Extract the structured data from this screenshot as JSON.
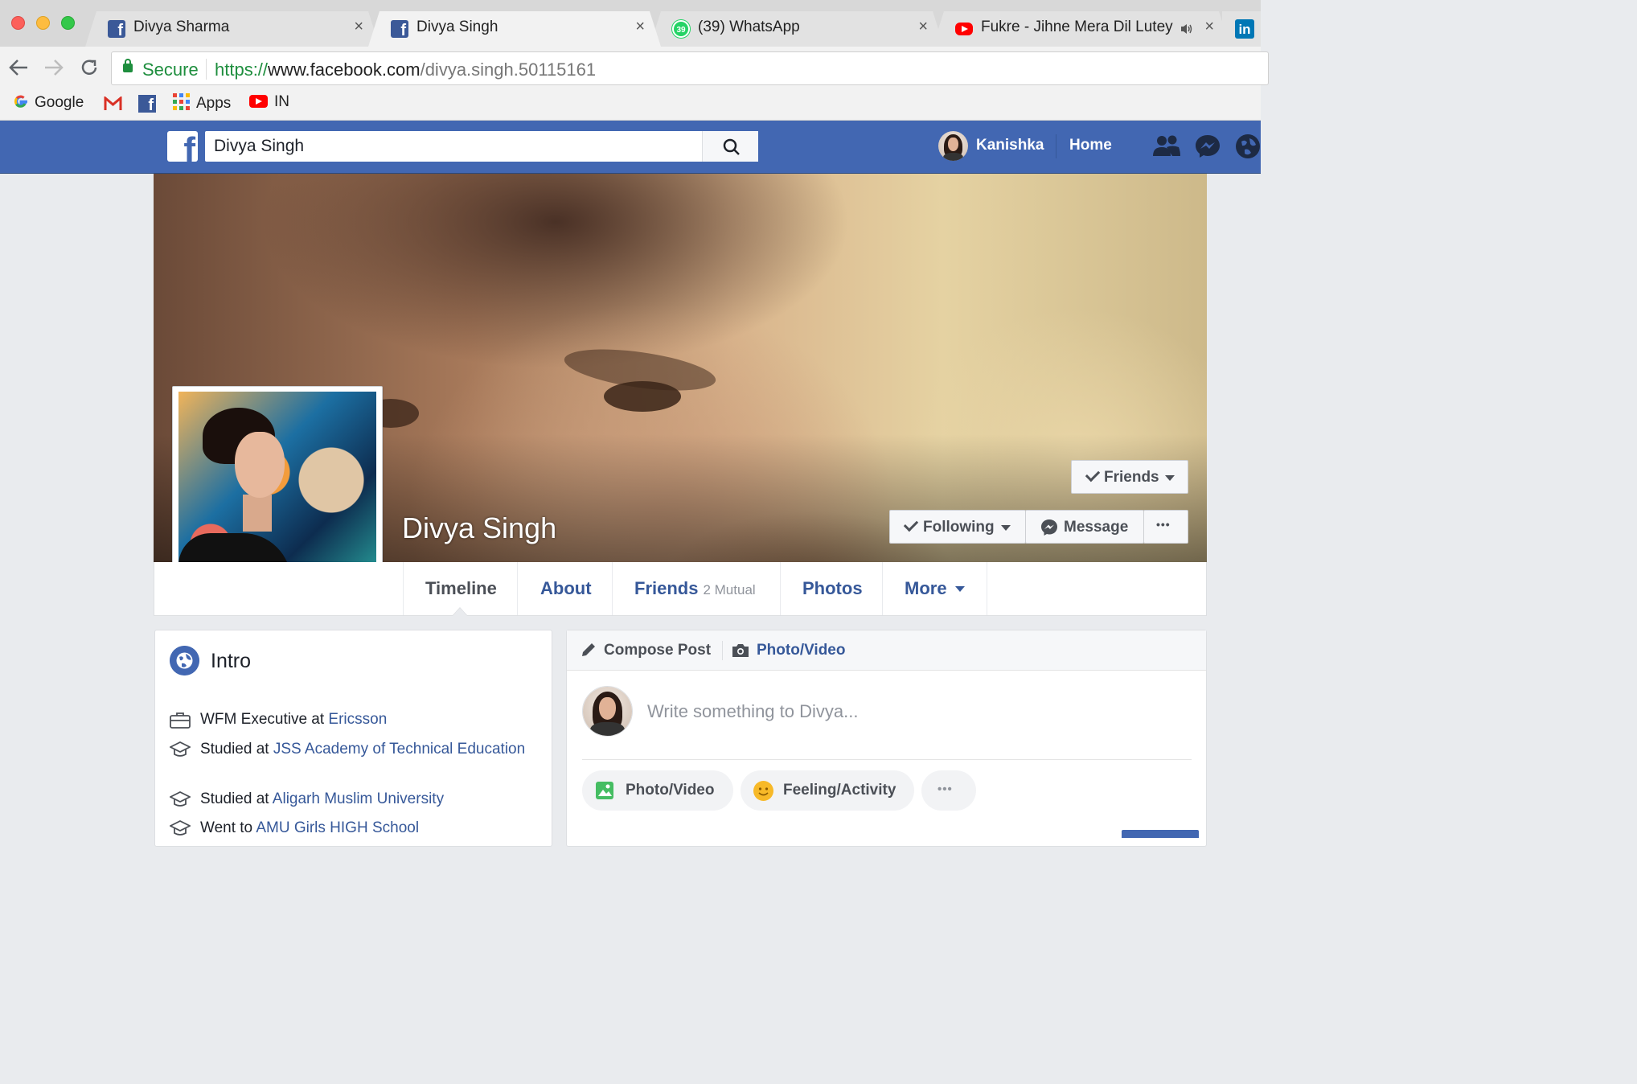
{
  "browser": {
    "tabs": [
      {
        "title": "Divya Sharma",
        "icon": "facebook-icon",
        "active": false
      },
      {
        "title": "Divya Singh",
        "icon": "facebook-icon",
        "active": true
      },
      {
        "title": "(39) WhatsApp",
        "icon": "whatsapp-icon",
        "badge": "39",
        "active": false
      },
      {
        "title": "Fukre - Jihne Mera Dil Lutey",
        "icon": "youtube-icon",
        "audio": true,
        "active": false
      }
    ],
    "linkedin_tab_icon": "in",
    "close_glyph": "×",
    "address": {
      "secure_label": "Secure",
      "scheme": "https://",
      "host": "www.facebook.com",
      "path": "/divya.singh.50115161"
    },
    "bookmarks": {
      "google": "Google",
      "apps": "Apps",
      "youtube_in": "IN"
    }
  },
  "fb_header": {
    "search_value": "Divya Singh",
    "user_name": "Kanishka",
    "home_label": "Home",
    "brand_color": "#4267b2"
  },
  "profile": {
    "name": "Divya Singh",
    "buttons": {
      "friends": "Friends",
      "following": "Following",
      "message": "Message",
      "more_dots": "•••"
    },
    "tabs": {
      "timeline": "Timeline",
      "about": "About",
      "friends": "Friends",
      "friends_mutual": "2 Mutual",
      "photos": "Photos",
      "more": "More"
    }
  },
  "intro": {
    "title": "Intro",
    "rows": [
      {
        "icon": "briefcase-icon",
        "prefix": "WFM Executive at ",
        "link": "Ericsson"
      },
      {
        "icon": "graduation-cap-icon",
        "prefix": "Studied at ",
        "link": "JSS Academy of Technical Education"
      },
      {
        "icon": "graduation-cap-icon",
        "prefix": "Studied at ",
        "link": "Aligarh Muslim University"
      },
      {
        "icon": "graduation-cap-icon",
        "prefix": "Went to ",
        "link": "AMU Girls HIGH School"
      }
    ]
  },
  "composer": {
    "compose_label": "Compose Post",
    "photo_video_label": "Photo/Video",
    "placeholder": "Write something to Divya...",
    "actions": {
      "photo_video": "Photo/Video",
      "feeling": "Feeling/Activity",
      "more": "•••"
    }
  }
}
